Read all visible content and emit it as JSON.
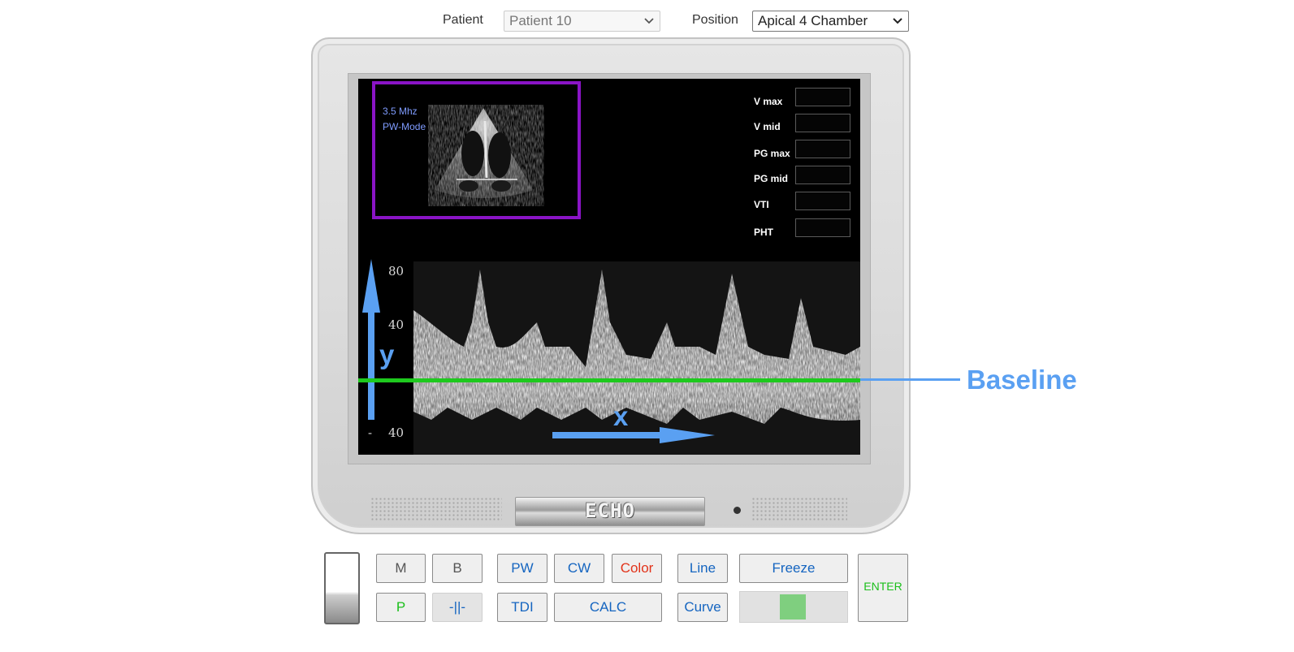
{
  "top": {
    "patient_label": "Patient",
    "patient_value": "Patient 10",
    "position_label": "Position",
    "position_value": "Apical 4 Chamber"
  },
  "screen": {
    "frequency": "3.5 Mhz",
    "mode": "PW-Mode",
    "measurements": [
      {
        "label": "V max",
        "value": ""
      },
      {
        "label": "V mid",
        "value": ""
      },
      {
        "label": "PG max",
        "value": ""
      },
      {
        "label": "PG mid",
        "value": ""
      },
      {
        "label": "VTI",
        "value": ""
      },
      {
        "label": "PHT",
        "value": ""
      }
    ],
    "scale": {
      "top": "80",
      "mid": "40",
      "minus_sign": "-",
      "bottom": "40"
    }
  },
  "annotations": {
    "y_axis": "y",
    "x_axis": "x",
    "baseline": "Baseline",
    "arrow_color": "#5aa0f2",
    "baseline_color": "#1ec91e"
  },
  "device": {
    "logo": "ECHO"
  },
  "controls": {
    "m": "M",
    "b": "B",
    "pw": "PW",
    "cw": "CW",
    "color": "Color",
    "line": "Line",
    "freeze": "Freeze",
    "enter": "ENTER",
    "p": "P",
    "separator": "-||-",
    "tdi": "TDI",
    "calc": "CALC",
    "curve": "Curve"
  },
  "colors": {
    "thumb_border": "#8a14c6",
    "freeze_indicator": "#7fcf7f"
  }
}
